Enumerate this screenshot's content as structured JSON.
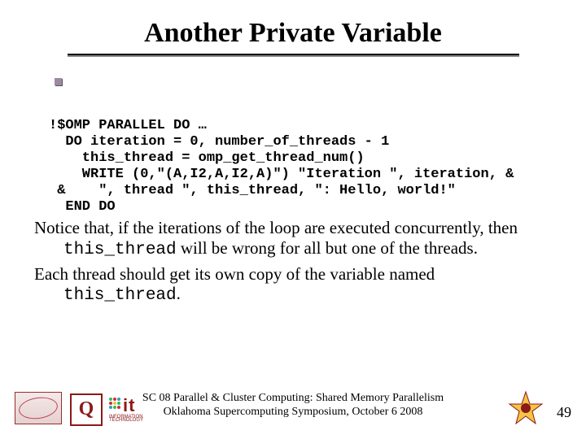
{
  "title": "Another Private Variable",
  "code": "!$OMP PARALLEL DO …\n  DO iteration = 0, number_of_threads - 1\n    this_thread = omp_get_thread_num()\n    WRITE (0,\"(A,I2,A,I2,A)\") \"Iteration \", iteration, &\n &    \", thread \", this_thread, \": Hello, world!\"\n  END DO",
  "para1_a": "Notice that, if the iterations of the loop are executed concurrently, then ",
  "para1_kw": "this_thread",
  "para1_b": " will be wrong for all but one of the threads.",
  "para2_a": "Each thread should get its own copy of the  variable named ",
  "para2_kw": "this_thread",
  "para2_b": ".",
  "footer_line1": "SC 08 Parallel & Cluster Computing: Shared Memory Parallelism",
  "footer_line2": "Oklahoma Supercomputing Symposium, October 6 2008",
  "page_number": "49",
  "ou_text": "Q",
  "it_text": "it",
  "it_sub1": "INFORMATION",
  "it_sub2": "TECHNOLOGY"
}
